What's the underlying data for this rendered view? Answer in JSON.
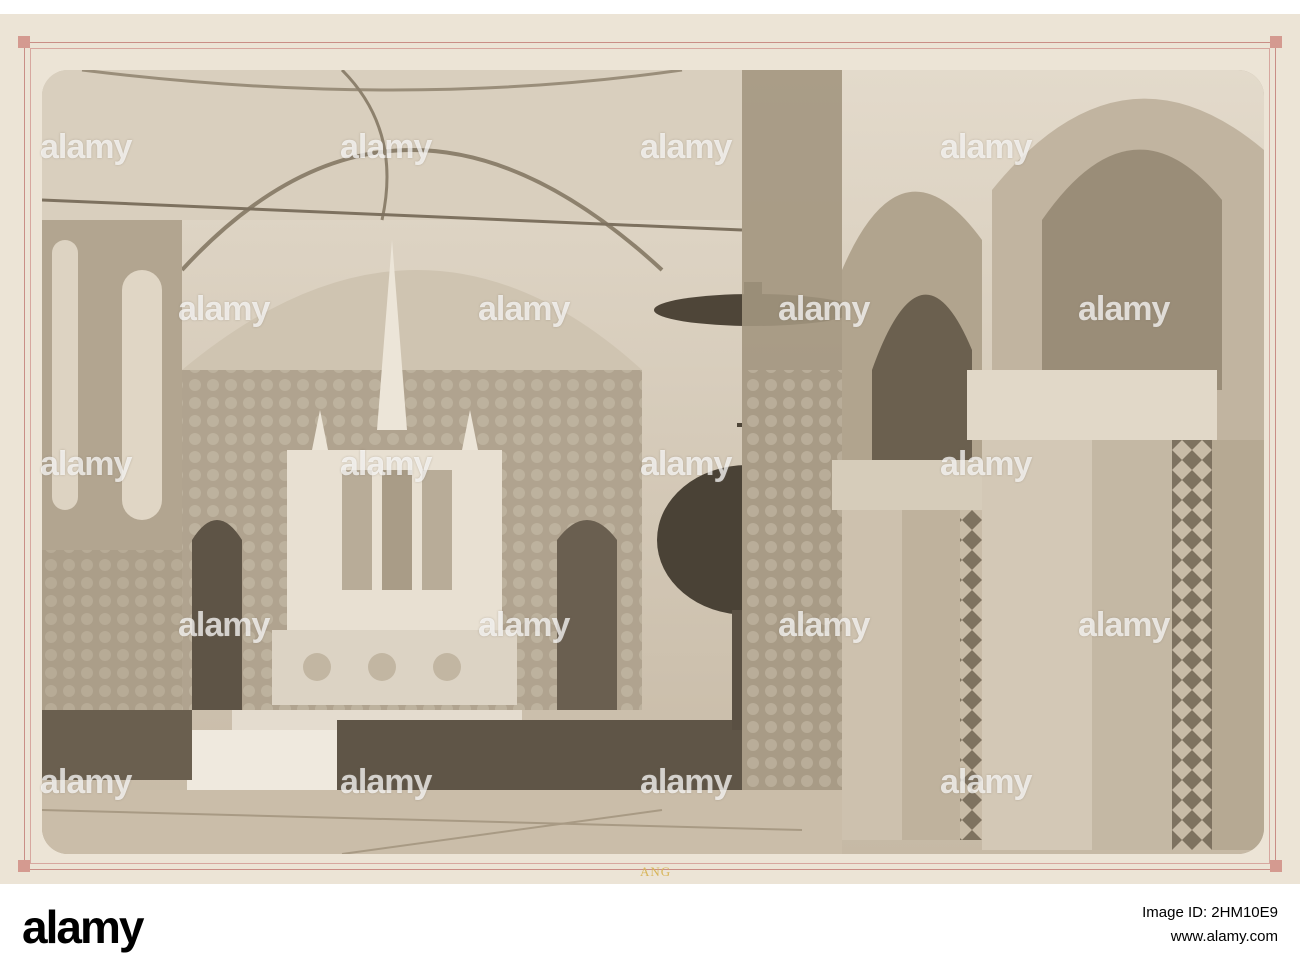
{
  "photo": {
    "subject": "church-interior",
    "card_mark": "ANG",
    "colors": {
      "card": "#ece4d6",
      "frame": "#c98e86",
      "sepia_light": "#ddd3c1",
      "sepia_mid": "#b7aa97",
      "sepia_dark": "#5e5446",
      "mark": "#d8b65a"
    }
  },
  "watermark": {
    "text": "alamy"
  },
  "stock_id": {
    "text": "Image ID: 2HM10E9",
    "site": "www.alamy.com"
  }
}
